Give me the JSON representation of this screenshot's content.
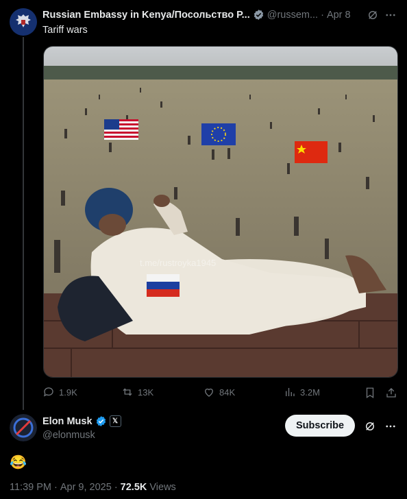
{
  "post": {
    "author_name": "Russian Embassy in Kenya/Посольство Р...",
    "handle": "@russem...",
    "separator": "·",
    "date": "Apr 8",
    "text": "Tariff wars",
    "watermark": "t.me/rustroyka1945",
    "actions": {
      "replies": "1.9K",
      "reposts": "13K",
      "likes": "84K",
      "views": "3.2M"
    }
  },
  "reply": {
    "author_name": "Elon Musk",
    "handle": "@elonmusk",
    "subscribe_label": "Subscribe",
    "text": "😂",
    "time": "11:39 PM",
    "date": "Apr 9, 2025",
    "views_count": "72.5K",
    "views_label": "Views",
    "separator": "·"
  },
  "colors": {
    "background": "#000000",
    "verified": "#1d9bf0",
    "muted": "#71767b"
  }
}
